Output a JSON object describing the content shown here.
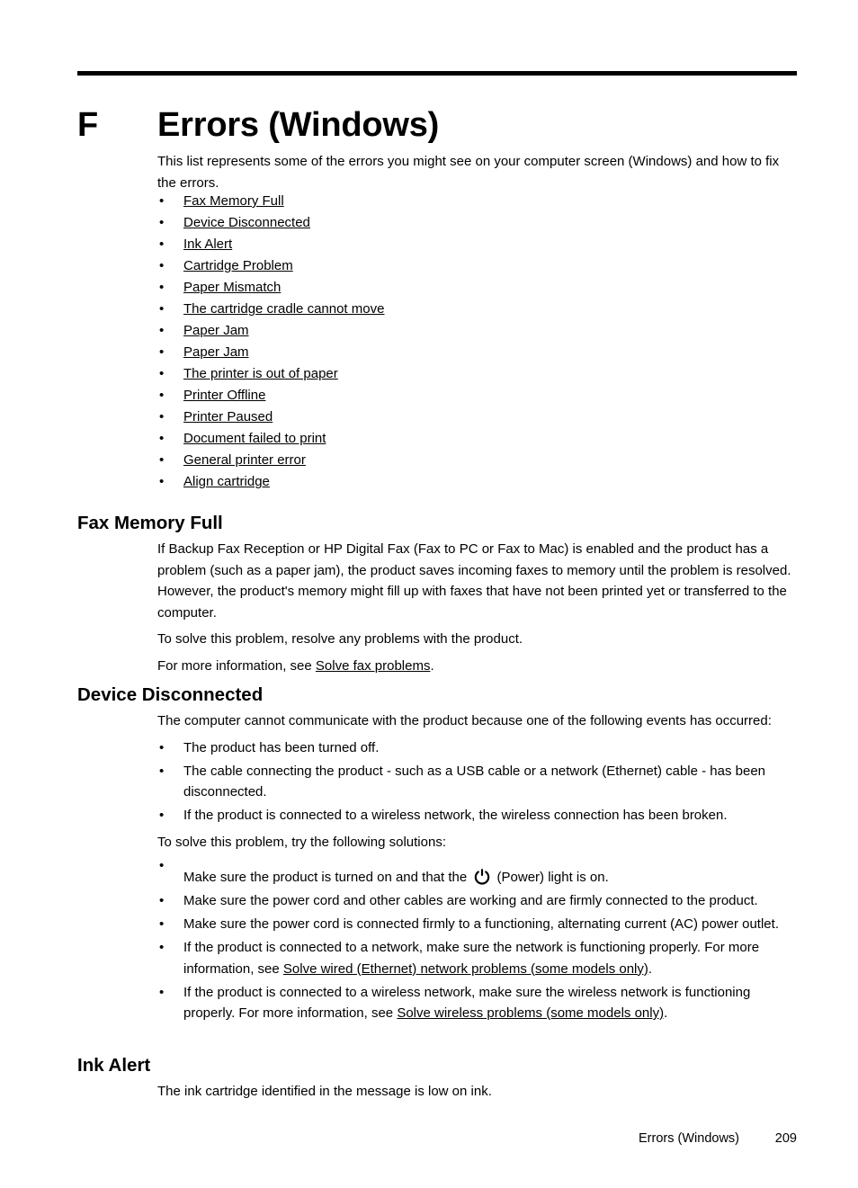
{
  "chapter": {
    "letter": "F",
    "title": "Errors (Windows)"
  },
  "intro": {
    "paragraph": "This list represents some of the errors you might see on your computer screen (Windows) and how to fix the errors.",
    "links": [
      "Fax Memory Full",
      "Device Disconnected",
      "Ink Alert",
      "Cartridge Problem",
      "Paper Mismatch",
      "The cartridge cradle cannot move",
      "Paper Jam",
      "Paper Jam",
      "The printer is out of paper",
      "Printer Offline",
      "Printer Paused",
      "Document failed to print",
      "General printer error",
      "Align cartridge"
    ]
  },
  "sections": {
    "fax_memory_full": {
      "heading": "Fax Memory Full",
      "paragraph1": "If Backup Fax Reception or HP Digital Fax (Fax to PC or Fax to Mac) is enabled and the product has a problem (such as a paper jam), the product saves incoming faxes to memory until the problem is resolved. However, the product's memory might fill up with faxes that have not been printed yet or transferred to the computer.",
      "paragraph2": "To solve this problem, resolve any problems with the product.",
      "paragraph3_prefix": "For more information, see ",
      "paragraph3_link": "Solve fax problems",
      "paragraph3_suffix": "."
    },
    "device_disconnected": {
      "heading": "Device Disconnected",
      "intro": "The computer cannot communicate with the product because one of the following events has occurred:",
      "causes": [
        "The product has been turned off.",
        "The cable connecting the product - such as a USB cable or a network (Ethernet) cable - has been disconnected.",
        "If the product is connected to a wireless network, the wireless connection has been broken."
      ],
      "solutions_intro": "To solve this problem, try the following solutions:",
      "solution1_before_icon": "Make sure the product is turned on and that the ",
      "solution1_after_icon": " (Power) light is on.",
      "solution2": "Make sure the power cord and other cables are working and are firmly connected to the product.",
      "solution3": "Make sure the power cord is connected firmly to a functioning, alternating current (AC) power outlet.",
      "solution4_prefix": "If the product is connected to a network, make sure the network is functioning properly. For more information, see ",
      "solution4_link": "Solve wired (Ethernet) network problems (some models only)",
      "solution4_suffix": ".",
      "solution5_prefix": "If the product is connected to a wireless network, make sure the wireless network is functioning properly. For more information, see ",
      "solution5_link": "Solve wireless problems (some models only)",
      "solution5_suffix": "."
    },
    "ink_alert": {
      "heading": "Ink Alert",
      "paragraph": "The ink cartridge identified in the message is low on ink."
    }
  },
  "icons": {
    "power": "power-icon"
  },
  "bullet_glyph": "•",
  "footer": {
    "title": "Errors (Windows)",
    "page": "209"
  }
}
